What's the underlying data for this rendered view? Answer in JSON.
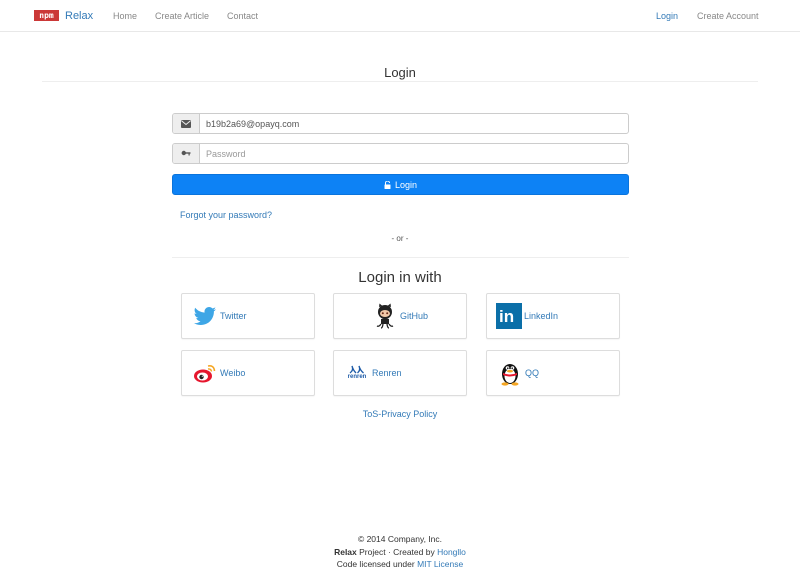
{
  "navbar": {
    "logo_text": "npm",
    "brand": "Relax",
    "links": [
      "Home",
      "Create Article",
      "Contact"
    ],
    "right_links": [
      "Login",
      "Create Account"
    ]
  },
  "form": {
    "title": "Login",
    "email_value": "b19b2a69@opayq.com",
    "password_placeholder": "Password",
    "login_button": "Login",
    "forgot": "Forgot your password?",
    "or": "- or -"
  },
  "social": {
    "heading": "Login in with",
    "items": [
      "Twitter",
      "GitHub",
      "LinkedIn",
      "Weibo",
      "Renren",
      "QQ"
    ],
    "renren_logo_text": "renren",
    "linkedin_logo_text": "in"
  },
  "tos": "ToS-Privacy Policy",
  "footer": {
    "copyright": "© 2014 Company, Inc.",
    "project_name": "Relax",
    "project_text": " Project · Created by ",
    "author": "Hongllo",
    "license_text": "Code licensed under ",
    "license": "MIT License"
  },
  "colors": {
    "accent": "#337ab7",
    "login_button": "#0d82f5",
    "npm_red": "#cb3837"
  }
}
